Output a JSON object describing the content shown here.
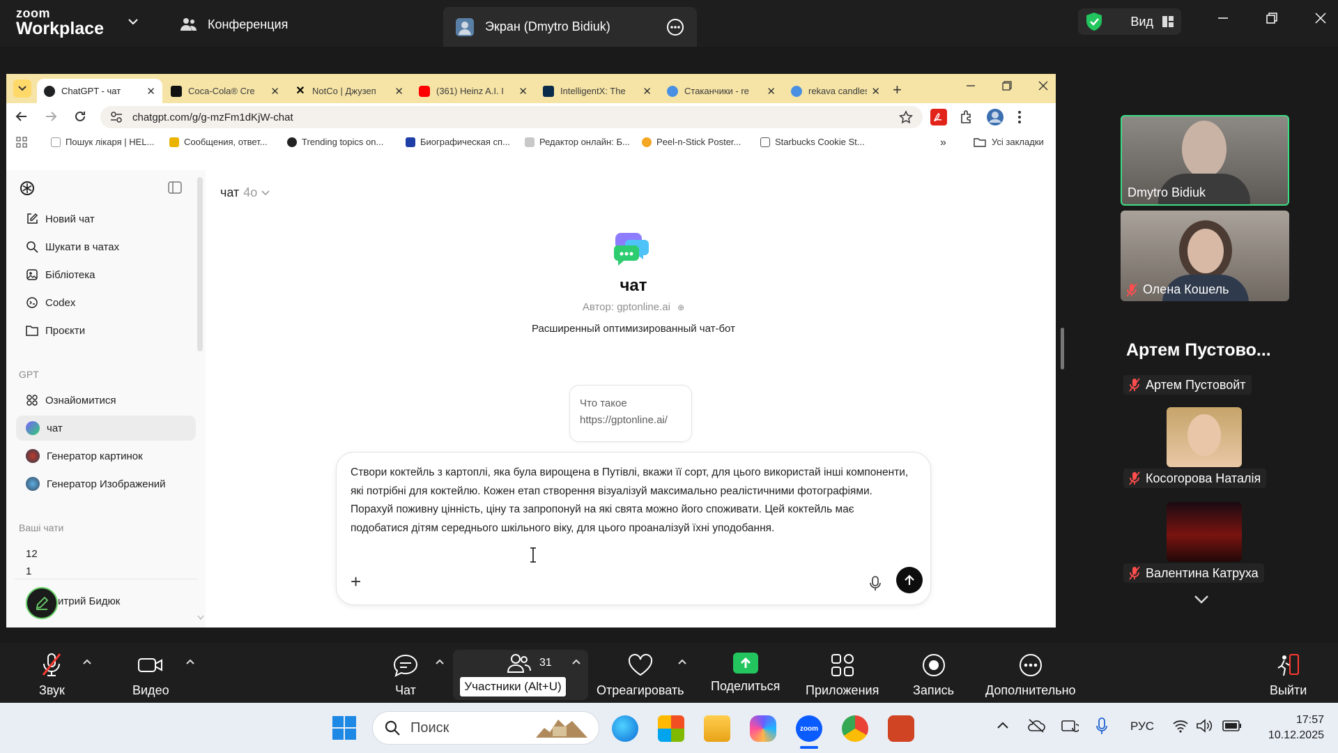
{
  "zoom": {
    "logo_line1": "zoom",
    "logo_line2": "Workplace",
    "conference": "Конференция",
    "screen_share_tab": "Экран (Dmytro Bidiuk)",
    "view_label": "Вид"
  },
  "browser": {
    "tabs": [
      {
        "label": "ChatGPT - чат",
        "color": "#202123"
      },
      {
        "label": "Coca-Cola® Cre",
        "color": "#111111"
      },
      {
        "label": "NotCo | Джузеп",
        "color": "#000000"
      },
      {
        "label": "(361) Heinz A.I. I",
        "color": "#ff0000"
      },
      {
        "label": "IntelligentX: The",
        "color": "#0b2b4a"
      },
      {
        "label": "Стаканчики - re",
        "color": "#4a90e2"
      },
      {
        "label": "rekava candles",
        "color": "#4a90e2"
      }
    ],
    "url": "chatgpt.com/g/g-mzFm1dKjW-chat",
    "bookmarks": [
      {
        "label": "Пошук лікаря | HEL...",
        "color": "#d0d0d0"
      },
      {
        "label": "Сообщения, ответ...",
        "color": "#e9b300"
      },
      {
        "label": "Trending topics on...",
        "color": "#222222"
      },
      {
        "label": "Биографическая сп...",
        "color": "#1e3fa6"
      },
      {
        "label": "Редактор онлайн: Б...",
        "color": "#9a9a9a"
      },
      {
        "label": "Peel-n-Stick Poster...",
        "color": "#f5a623"
      },
      {
        "label": "Starbucks Cookie St...",
        "color": "#555555"
      }
    ],
    "all_bookmarks": "Усі закладки"
  },
  "chatgpt": {
    "sidebar": {
      "items": [
        "Новий чат",
        "Шукати в чатах",
        "Бібліотека",
        "Codex",
        "Проєкти"
      ],
      "gpt_section": "GPT",
      "gpts": [
        "Ознайомитися",
        "чат",
        "Генератор картинок",
        "Генератор Изображений"
      ],
      "chats_section": "Ваші чати",
      "chats": [
        "12",
        "1"
      ],
      "user": "итрий Бидюк"
    },
    "model_label": "чат",
    "model_version": "4o",
    "gpt_title": "чат",
    "gpt_author": "Автор: gptonline.ai",
    "gpt_description": "Расширенный оптимизированный чат-бот",
    "suggestion_line1": "Что такое",
    "suggestion_line2": "https://gptonline.ai/",
    "prompt_text": "Створи коктейль з картоплі, яка була вирощена в Путівлі, вкажи її сорт, для цього використай інші компоненти, які потрібні для коктейлю. Кожен етап створення візуалізуй максимально реалістичними фотографіями. Порахуй поживну цінність, ціну та запропонуй на які свята можно його споживати. Цей коктейль має подобатися дітям середнього шкільного віку, для цього проаналізуй їхні уподобання."
  },
  "participants": {
    "tiles": [
      "Dmytro Bidiuk",
      "Олена Кошель"
    ],
    "group_title": "Артем Пустово...",
    "list": [
      "Артем Пустовойт",
      "Косогорова Наталія",
      "Валентина Катруха"
    ]
  },
  "toolbar": {
    "audio": "Звук",
    "video": "Видео",
    "chat": "Чат",
    "participants_count": "31",
    "participants_tooltip": "Участники (Alt+U)",
    "react": "Отреагировать",
    "share": "Поделиться",
    "apps": "Приложения",
    "record": "Запись",
    "more": "Дополнительно",
    "leave": "Выйти"
  },
  "taskbar": {
    "search_placeholder": "Поиск",
    "language": "РУС",
    "time": "17:57",
    "date": "10.12.2025"
  },
  "colors": {
    "zoom_bg": "#1e1e1e",
    "tab_strip": "#f6e4a6",
    "share_green": "#22c55e",
    "active_speaker": "#3ddc84"
  }
}
